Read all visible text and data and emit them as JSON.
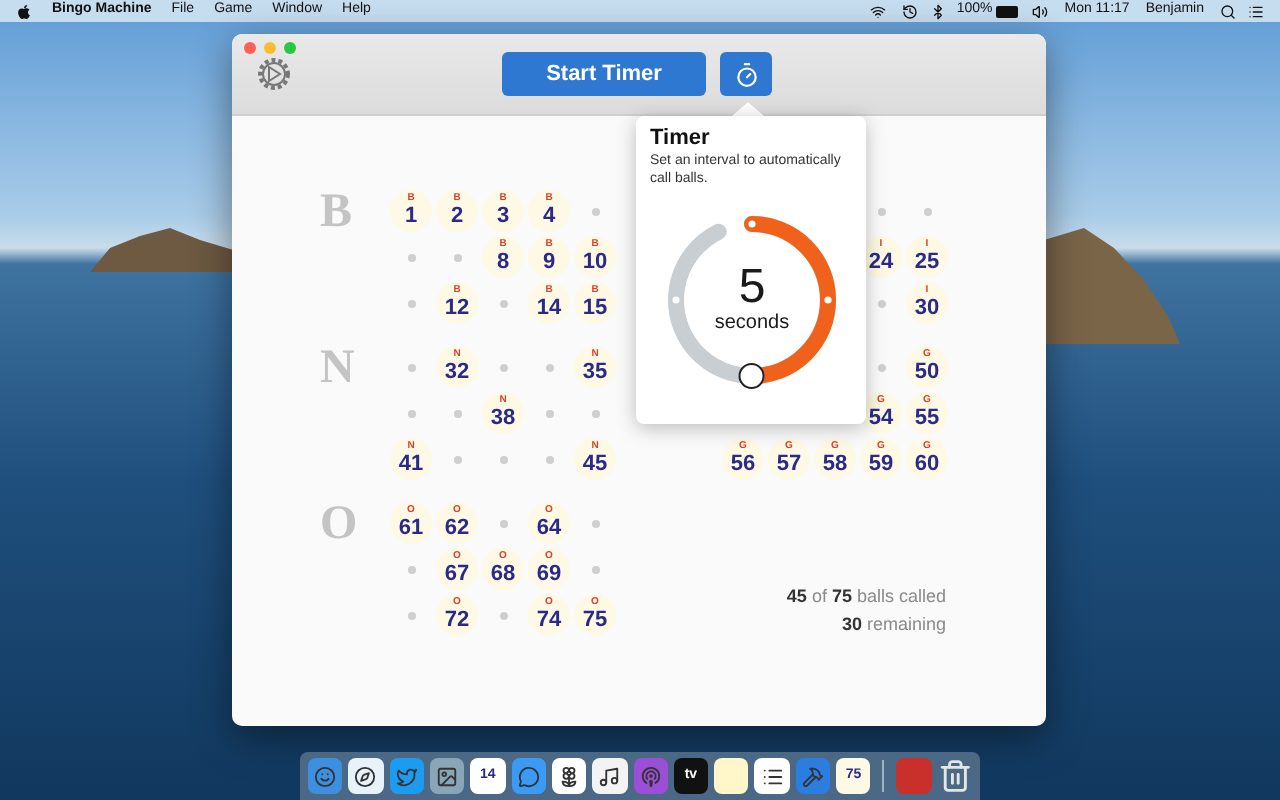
{
  "menu_bar": {
    "app_name": "Bingo Machine",
    "menus": [
      "File",
      "Game",
      "Window",
      "Help"
    ],
    "battery": "100%",
    "clock": "Mon 11:17",
    "user": "Benjamin"
  },
  "toolbar": {
    "start_button": "Start Timer"
  },
  "left_blocks": [
    {
      "letter": "B",
      "rows": [
        [
          {
            "kind": "ball",
            "letter": "B",
            "number": "1"
          },
          {
            "kind": "ball",
            "letter": "B",
            "number": "2"
          },
          {
            "kind": "ball",
            "letter": "B",
            "number": "3"
          },
          {
            "kind": "ball",
            "letter": "B",
            "number": "4"
          },
          {
            "kind": "dot"
          }
        ],
        [
          {
            "kind": "dot"
          },
          {
            "kind": "dot"
          },
          {
            "kind": "ball",
            "letter": "B",
            "number": "8"
          },
          {
            "kind": "ball",
            "letter": "B",
            "number": "9"
          },
          {
            "kind": "ball",
            "letter": "B",
            "number": "10"
          }
        ],
        [
          {
            "kind": "dot"
          },
          {
            "kind": "ball",
            "letter": "B",
            "number": "12"
          },
          {
            "kind": "dot"
          },
          {
            "kind": "ball",
            "letter": "B",
            "number": "14"
          },
          {
            "kind": "ball",
            "letter": "B",
            "number": "15"
          }
        ]
      ]
    },
    {
      "letter": "N",
      "rows": [
        [
          {
            "kind": "dot"
          },
          {
            "kind": "ball",
            "letter": "N",
            "number": "32"
          },
          {
            "kind": "dot"
          },
          {
            "kind": "dot"
          },
          {
            "kind": "ball",
            "letter": "N",
            "number": "35"
          }
        ],
        [
          {
            "kind": "dot"
          },
          {
            "kind": "dot"
          },
          {
            "kind": "ball",
            "letter": "N",
            "number": "38"
          },
          {
            "kind": "dot"
          },
          {
            "kind": "dot"
          }
        ],
        [
          {
            "kind": "ball",
            "letter": "N",
            "number": "41"
          },
          {
            "kind": "dot"
          },
          {
            "kind": "dot"
          },
          {
            "kind": "dot"
          },
          {
            "kind": "ball",
            "letter": "N",
            "number": "45"
          }
        ]
      ]
    },
    {
      "letter": "O",
      "rows": [
        [
          {
            "kind": "ball",
            "letter": "O",
            "number": "61"
          },
          {
            "kind": "ball",
            "letter": "O",
            "number": "62"
          },
          {
            "kind": "dot"
          },
          {
            "kind": "ball",
            "letter": "O",
            "number": "64"
          },
          {
            "kind": "dot"
          }
        ],
        [
          {
            "kind": "dot"
          },
          {
            "kind": "ball",
            "letter": "O",
            "number": "67"
          },
          {
            "kind": "ball",
            "letter": "O",
            "number": "68"
          },
          {
            "kind": "ball",
            "letter": "O",
            "number": "69"
          },
          {
            "kind": "dot"
          }
        ],
        [
          {
            "kind": "dot"
          },
          {
            "kind": "ball",
            "letter": "O",
            "number": "72"
          },
          {
            "kind": "dot"
          },
          {
            "kind": "ball",
            "letter": "O",
            "number": "74"
          },
          {
            "kind": "ball",
            "letter": "O",
            "number": "75"
          }
        ]
      ]
    }
  ],
  "right_blocks": [
    {
      "rows": [
        [
          {
            "kind": "covered"
          },
          {
            "kind": "covered"
          },
          {
            "kind": "covered"
          },
          {
            "kind": "dot"
          },
          {
            "kind": "dot"
          }
        ],
        [
          {
            "kind": "covered"
          },
          {
            "kind": "covered"
          },
          {
            "kind": "covered"
          },
          {
            "kind": "ball",
            "letter": "I",
            "number": "24"
          },
          {
            "kind": "ball",
            "letter": "I",
            "number": "25"
          }
        ],
        [
          {
            "kind": "covered"
          },
          {
            "kind": "covered"
          },
          {
            "kind": "covered"
          },
          {
            "kind": "dot"
          },
          {
            "kind": "ball",
            "letter": "I",
            "number": "30"
          }
        ]
      ]
    },
    {
      "rows": [
        [
          {
            "kind": "covered"
          },
          {
            "kind": "covered"
          },
          {
            "kind": "covered"
          },
          {
            "kind": "dot"
          },
          {
            "kind": "ball",
            "letter": "G",
            "number": "50"
          }
        ],
        [
          {
            "kind": "covered"
          },
          {
            "kind": "covered"
          },
          {
            "kind": "covered"
          },
          {
            "kind": "ball",
            "letter": "G",
            "number": "54"
          },
          {
            "kind": "ball",
            "letter": "G",
            "number": "55"
          }
        ],
        [
          {
            "kind": "ball",
            "letter": "G",
            "number": "56"
          },
          {
            "kind": "ball",
            "letter": "G",
            "number": "57"
          },
          {
            "kind": "ball",
            "letter": "G",
            "number": "58"
          },
          {
            "kind": "ball",
            "letter": "G",
            "number": "59"
          },
          {
            "kind": "ball",
            "letter": "G",
            "number": "60"
          }
        ]
      ]
    }
  ],
  "status": [
    "**45** of **75** balls called",
    "**30** remaining"
  ],
  "timer": {
    "title": "Timer",
    "description": "Set an interval to automatically call balls.",
    "value": "5",
    "unit": "seconds",
    "level": 0.54
  },
  "dock": {
    "calendar_date": "14",
    "tv_label": "tv",
    "bingo_badge": "75"
  }
}
